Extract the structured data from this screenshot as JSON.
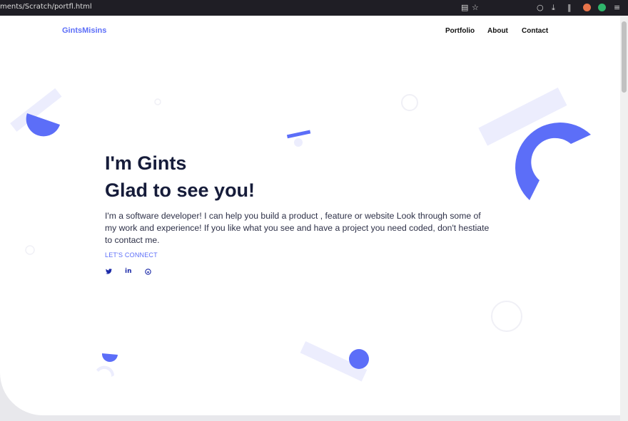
{
  "browser": {
    "url": "ments/Scratch/portfl.html",
    "icons": [
      "reader-view-icon",
      "bookmark-star-icon",
      "pocket-icon",
      "download-icon",
      "library-icon",
      "extension-icon",
      "account-icon",
      "menu-icon"
    ]
  },
  "header": {
    "logo": "GintsMisins",
    "nav": [
      "Portfolio",
      "About",
      "Contact"
    ]
  },
  "hero": {
    "line1": "I'm Gints",
    "line2": "Glad to see you!",
    "intro": "I'm a software developer! I can help you build a product , feature or website Look through some of my work and experience! If you like what you see and have a project you need coded, don't hestiate to contact me.",
    "cta": "LET'S CONNECT",
    "social": {
      "twitter": "❩",
      "linkedin": "in",
      "github": "○"
    }
  },
  "colors": {
    "accent": "#5c6ef8",
    "pale": "#ecedfd",
    "heading": "#161c3a"
  }
}
